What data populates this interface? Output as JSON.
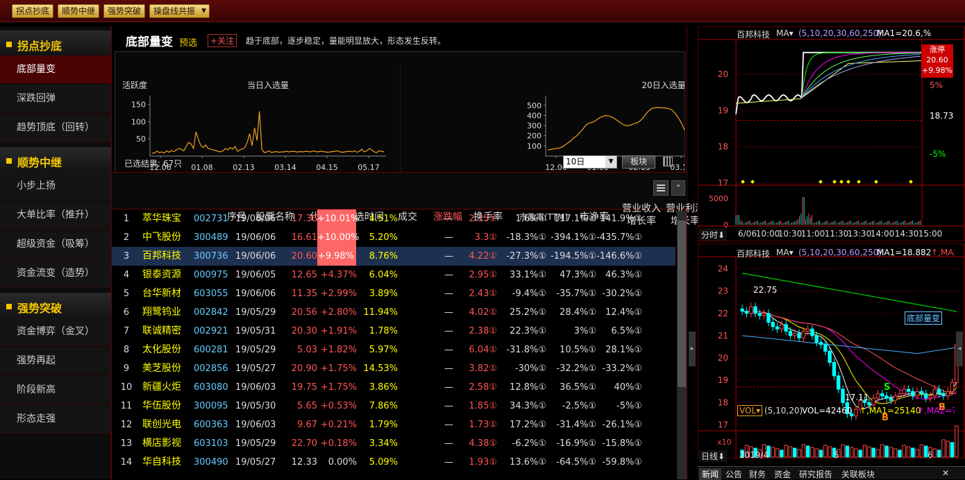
{
  "toolbar": {
    "buttons": [
      "拐点抄底",
      "顺势中继",
      "强势突破",
      "操盘线共振"
    ]
  },
  "sidebar": {
    "sec1": "拐点抄底",
    "items1": [
      "底部量变",
      "深跌回弹",
      "趋势顶底（回转）"
    ],
    "sec2": "顺势中继",
    "items2": [
      "小步上扬",
      "大单比率（推升）",
      "超级资金（吸筹）",
      "资金流变（造势）"
    ],
    "sec3": "强势突破",
    "items3": [
      "资金博弈（金叉）",
      "强势再起",
      "阶段新高",
      "形态走强"
    ]
  },
  "panel": {
    "title": "底部量变",
    "subtitle": "预选",
    "follow": "+关注",
    "desc": "趋于底部，逐步稳定，量能明显放大，形态发生反转。"
  },
  "chart_data": [
    {
      "type": "line",
      "title": "当日入选量",
      "ylabel": "活跃度",
      "yticks": [
        "150",
        "100",
        "50"
      ],
      "xticks": [
        "12.06",
        "01.08",
        "02.13",
        "03.14",
        "04.15",
        "05.17"
      ],
      "color": "#f0a020",
      "values": [
        8,
        9,
        14,
        10,
        12,
        9,
        15,
        11,
        16,
        13,
        18,
        22,
        20,
        15,
        28,
        40,
        35,
        22,
        70,
        48,
        30,
        25,
        32,
        22,
        20,
        18,
        16,
        14,
        12,
        15,
        22,
        18,
        25,
        20,
        28,
        14,
        18,
        20,
        25,
        40,
        65,
        30,
        82,
        45,
        130,
        20,
        10,
        12,
        15,
        10,
        12,
        13,
        11,
        12,
        12,
        14,
        12,
        13,
        14,
        12,
        12,
        13,
        12,
        14,
        13,
        12,
        15,
        13,
        12,
        14,
        13,
        12,
        11,
        12,
        13,
        14,
        15,
        12,
        11,
        12,
        13,
        14,
        12,
        15,
        11,
        14,
        20,
        12,
        15,
        22,
        18,
        12,
        10,
        15,
        14,
        12
      ]
    },
    {
      "type": "line",
      "title": "20日入选量",
      "yticks": [
        "500",
        "400",
        "300",
        "200",
        "100"
      ],
      "xticks": [
        "12.06",
        "01.08",
        "02.13",
        "03.14",
        "04.15",
        "05.17"
      ],
      "color": "#f0a020",
      "values": [
        60,
        65,
        70,
        75,
        80,
        90,
        110,
        130,
        150,
        180,
        200,
        230,
        260,
        300,
        320,
        330,
        340,
        360,
        380,
        390,
        400,
        395,
        385,
        370,
        350,
        330,
        310,
        300,
        300,
        310,
        320,
        330,
        350,
        380,
        420,
        450,
        470,
        475,
        478,
        476,
        474,
        472,
        465,
        450,
        420,
        380,
        330,
        270,
        200,
        120,
        80,
        55,
        52,
        50,
        50,
        52,
        55,
        54,
        53,
        55,
        52,
        54,
        56,
        57,
        58,
        56,
        55,
        54,
        55,
        56,
        60,
        65,
        75,
        85,
        95,
        100,
        110,
        120,
        130,
        140,
        150
      ]
    }
  ],
  "filter": {
    "result": "已选结果: 67只",
    "period": "10日",
    "sector": "板块"
  },
  "table": {
    "headers": [
      "序号",
      "股票名称",
      "代码",
      "入选时间",
      "成交",
      "涨跌幅",
      "换手率",
      "市盈率(TTM)",
      "市净率"
    ],
    "headers2": [
      [
        "营业收入",
        "增长率"
      ],
      [
        "营业利润",
        "增长率"
      ],
      [
        "净利润",
        "增长率"
      ]
    ],
    "rows": [
      [
        "1",
        "萃华珠宝",
        "002731",
        "19/06/06",
        "17.36",
        "+10.01%",
        "4.51%",
        "—",
        "2.15①",
        "1.6%①",
        "117.1%①",
        "141.9%①"
      ],
      [
        "2",
        "中飞股份",
        "300489",
        "19/06/06",
        "16.61",
        "+10.00%",
        "5.20%",
        "—",
        "3.3①",
        "-18.3%①",
        "-394.1%①",
        "-435.7%①"
      ],
      [
        "3",
        "百邦科技",
        "300736",
        "19/06/06",
        "20.60",
        "+9.98%",
        "8.76%",
        "—",
        "4.22①",
        "-27.3%①",
        "-194.5%①",
        "-146.6%①"
      ],
      [
        "4",
        "银泰资源",
        "000975",
        "19/06/05",
        "12.65",
        "+4.37%",
        "6.04%",
        "—",
        "2.95①",
        "33.1%①",
        "47.3%①",
        "46.3%①"
      ],
      [
        "5",
        "台华新材",
        "603055",
        "19/06/06",
        "11.35",
        "+2.99%",
        "3.89%",
        "—",
        "2.43①",
        "-9.4%①",
        "-35.7%①",
        "-30.2%①"
      ],
      [
        "6",
        "翔鹭钨业",
        "002842",
        "19/05/29",
        "20.56",
        "+2.80%",
        "11.94%",
        "—",
        "4.02①",
        "25.2%①",
        "28.4%①",
        "12.4%①"
      ],
      [
        "7",
        "联诚精密",
        "002921",
        "19/05/31",
        "20.30",
        "+1.91%",
        "1.78%",
        "—",
        "2.38①",
        "22.3%①",
        "3%①",
        "6.5%①"
      ],
      [
        "8",
        "太化股份",
        "600281",
        "19/05/29",
        "5.03",
        "+1.82%",
        "5.97%",
        "—",
        "6.04①",
        "-31.8%①",
        "10.5%①",
        "28.1%①"
      ],
      [
        "9",
        "美芝股份",
        "002856",
        "19/05/27",
        "20.90",
        "+1.75%",
        "14.53%",
        "—",
        "3.82①",
        "-30%①",
        "-32.2%①",
        "-33.2%①"
      ],
      [
        "10",
        "新疆火炬",
        "603080",
        "19/06/03",
        "19.75",
        "+1.75%",
        "3.86%",
        "—",
        "2.58①",
        "12.8%①",
        "36.5%①",
        "40%①"
      ],
      [
        "11",
        "华伍股份",
        "300095",
        "19/05/30",
        "5.65",
        "+0.53%",
        "7.86%",
        "—",
        "1.85①",
        "34.3%①",
        "-2.5%①",
        "-5%①"
      ],
      [
        "12",
        "联创光电",
        "600363",
        "19/06/03",
        "9.67",
        "+0.21%",
        "1.79%",
        "—",
        "1.73①",
        "17.2%①",
        "-31.4%①",
        "-26.1%①"
      ],
      [
        "13",
        "横店影视",
        "603103",
        "19/05/29",
        "22.70",
        "+0.18%",
        "3.34%",
        "—",
        "4.38①",
        "-6.2%①",
        "-16.9%①",
        "-15.8%①"
      ],
      [
        "14",
        "华自科技",
        "300490",
        "19/05/27",
        "12.33",
        "0.00%",
        "5.09%",
        "—",
        "1.93①",
        "13.6%①",
        "-64.5%①",
        "-59.8%①"
      ]
    ]
  },
  "intraday": {
    "name": "百邦科技",
    "ma_label": "MA▾",
    "ma_params": "(5,10,20,30,60,250)",
    "ma1": "MA1=20.6,%",
    "price_ticks": [
      "20",
      "19",
      "18",
      "17"
    ],
    "pct_ticks": [
      "10%",
      "5%",
      "-5%"
    ],
    "mid": "18.73",
    "badge": [
      "涨停",
      "20.60",
      "+9.98%"
    ],
    "vol_ticks": [
      "5000",
      "0"
    ],
    "times": [
      "6/06",
      "10:00",
      "10:30",
      "11:00",
      "11:30",
      "13:30",
      "14:00",
      "14:30",
      "15:00"
    ],
    "tab": "分时"
  },
  "daily": {
    "name": "百邦科技",
    "ma_label": "MA▾",
    "ma_params": "(5,10,20,30,60,250)",
    "ma1": "MA1=18.882",
    "ma2": "↑,MA2=",
    "price_ticks": [
      "24",
      "23",
      "22",
      "21",
      "20",
      "19",
      "18",
      "17"
    ],
    "hi": "22.75",
    "lo": "17.11",
    "tag": "底部量变",
    "vol_label": "VOL▾",
    "vol_params": "(5,10,20)",
    "vol_val": "VOL=42460",
    "vol_ma1": "↑,MA1=25140",
    "vol_ma2": "↑,MA2=?",
    "x10": "x10",
    "xticks": [
      "2019/4",
      "5",
      "6"
    ],
    "tab": "日线"
  },
  "bottom_tabs": [
    "新闻",
    "公告",
    "财务",
    "资金",
    "研究报告",
    "关联板块"
  ]
}
